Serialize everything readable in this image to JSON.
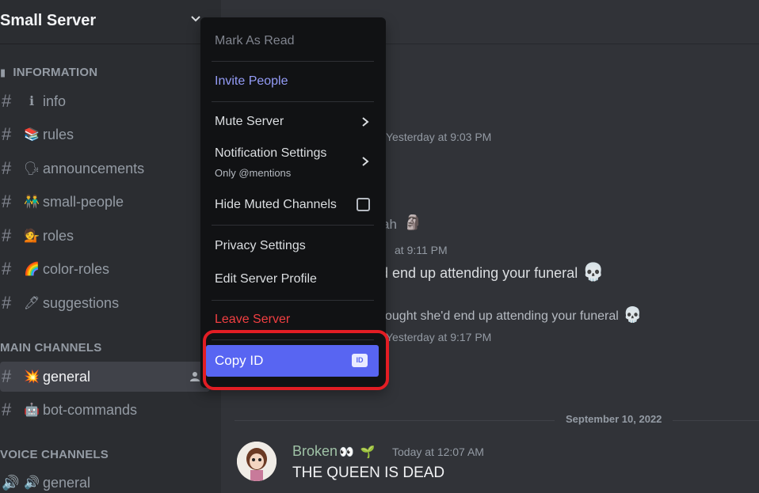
{
  "server": {
    "name": "Small Server",
    "chevron_icon": "chevron-down-icon"
  },
  "categories": {
    "information": "INFORMATION",
    "main": "MAIN CHANNELS",
    "voice": "VOICE CHANNELS"
  },
  "channels": {
    "info": {
      "emoji": "ℹ",
      "label": "info"
    },
    "rules": {
      "emoji": "📚",
      "label": "rules"
    },
    "announcements": {
      "emoji": "🗣",
      "label": "announcements"
    },
    "small_people": {
      "emoji": "👬",
      "label": "small-people"
    },
    "roles": {
      "emoji": "💁",
      "label": "roles"
    },
    "color_roles": {
      "emoji": "🌈",
      "label": "color-roles"
    },
    "suggestions": {
      "emoji": "🖊",
      "label": "suggestions"
    },
    "general": {
      "emoji": "💥",
      "label": "general"
    },
    "bot_commands": {
      "emoji": "🤖",
      "label": "bot-commands"
    },
    "voice_general": {
      "emoji": "🔊",
      "label": "general"
    }
  },
  "menu": {
    "mark_as_read": "Mark As Read",
    "invite_people": "Invite People",
    "mute_server": "Mute Server",
    "notification_settings": "Notification Settings",
    "notification_sub": "Only @mentions",
    "hide_muted": "Hide Muted Channels",
    "privacy_settings": "Privacy Settings",
    "edit_server_profile": "Edit Server Profile",
    "leave_server": "Leave Server",
    "copy_id": "Copy ID",
    "id_badge": "ID"
  },
  "chat": {
    "time1": "Yesterday at 9:03 PM",
    "fragment_ah": "ah",
    "time2": "at 9:11 PM",
    "msg1": "d end up attending your funeral",
    "msg2": "ought she'd end up attending your funeral",
    "time3": "Yesterday at 9:17 PM",
    "date_divider": "September 10, 2022",
    "author": "Broken",
    "author_time": "Today at 12:07 AM",
    "message": "THE QUEEN IS DEAD"
  },
  "colors": {
    "accent": "#5865f2",
    "danger": "#f23f42",
    "invite": "#949cf7",
    "highlight": "#e21d24"
  }
}
